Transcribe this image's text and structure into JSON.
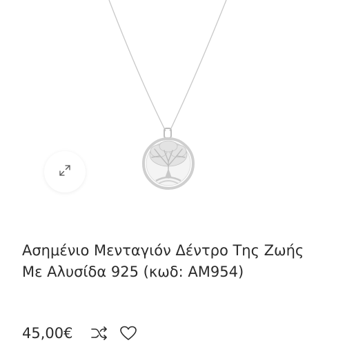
{
  "product": {
    "title": "Ασημένιο Μενταγιόν Δέντρο Της Ζωής Με Αλυσίδα 925 (κωδ: ΑΜ954)",
    "price": "45,00€"
  },
  "icons": {
    "zoom": "expand-icon",
    "compare": "shuffle-icon",
    "wishlist": "heart-icon"
  }
}
